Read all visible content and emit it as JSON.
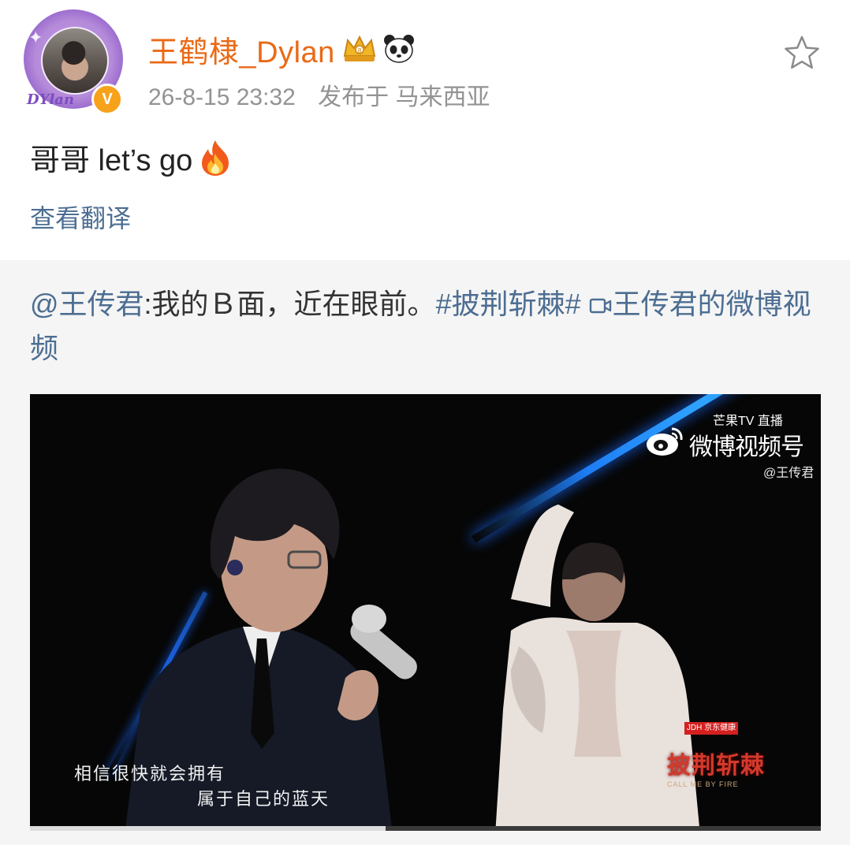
{
  "post": {
    "author": {
      "name": "王鹤棣_Dylan",
      "avatar_tag": "DYlan",
      "verified_mark": "V",
      "icons": [
        "crown-badge-icon",
        "panda-icon"
      ]
    },
    "timestamp": "26-8-15 23:32",
    "location": "发布于 马来西亚",
    "text": "哥哥 let’s go",
    "emoji": "fire-icon",
    "translate_label": "查看翻译",
    "favorite_icon": "star-icon"
  },
  "repost": {
    "mention": "@王传君",
    "body": ":我的Ｂ面，近在眼前。",
    "hashtag": "#披荆斩棘#",
    "video_link": "王传君的微博视频",
    "video": {
      "watermark_brand": "微博视频号",
      "watermark_mgtv": "芒果TV",
      "watermark_live": "直播",
      "watermark_handle": "@王传君",
      "subtitle_line1": "相信很快就会拥有",
      "subtitle_line2": "属于自己的蓝天",
      "show_title": "披荆斩棘",
      "show_sponsor": "JDH 京东健康",
      "show_subtitle": "CALL ME BY FIRE",
      "progress": 0.45
    }
  },
  "colors": {
    "username": "#ea6a16",
    "link": "#4d6e92",
    "meta": "#939393",
    "repost_bg": "#f5f5f5"
  }
}
